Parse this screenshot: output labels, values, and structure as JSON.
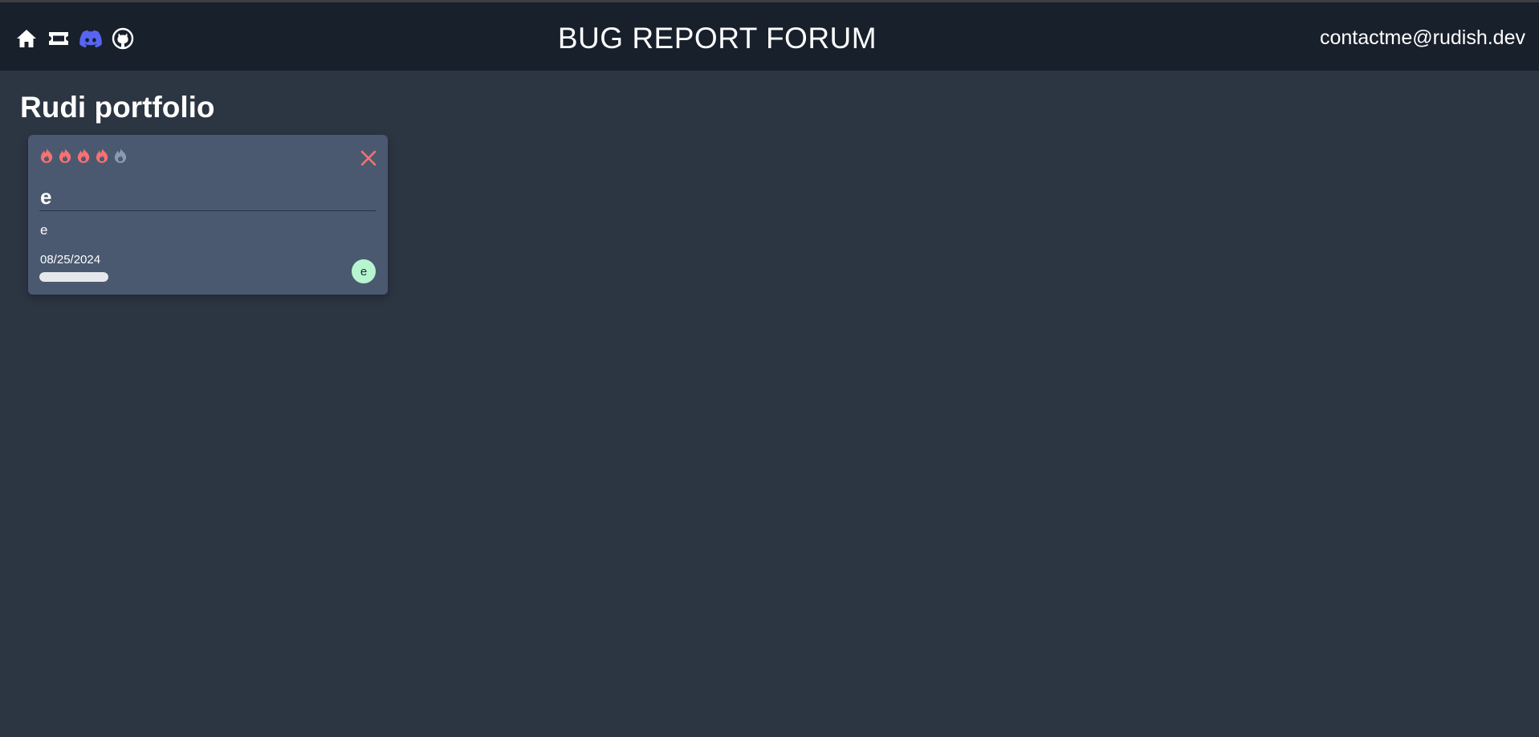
{
  "header": {
    "title": "BUG REPORT FORUM",
    "contact_email": "contactme@rudish.dev",
    "nav_icons": [
      {
        "name": "home-icon"
      },
      {
        "name": "ticket-icon"
      },
      {
        "name": "discord-icon"
      },
      {
        "name": "github-icon"
      }
    ]
  },
  "project": {
    "title": "Rudi portfolio"
  },
  "card": {
    "severity": 4,
    "severity_max": 5,
    "title": "e",
    "description": "e",
    "date": "08/25/2024",
    "progress": 1.0,
    "avatar_initial": "e"
  },
  "colors": {
    "header_bg": "#18202c",
    "page_bg": "#2c3542",
    "card_bg": "#4a5970",
    "flame_active": "#f87171",
    "flame_inactive": "#8a9ab3",
    "close": "#f87171",
    "discord": "#5865f2",
    "avatar_bg": "#b7f4d0"
  }
}
